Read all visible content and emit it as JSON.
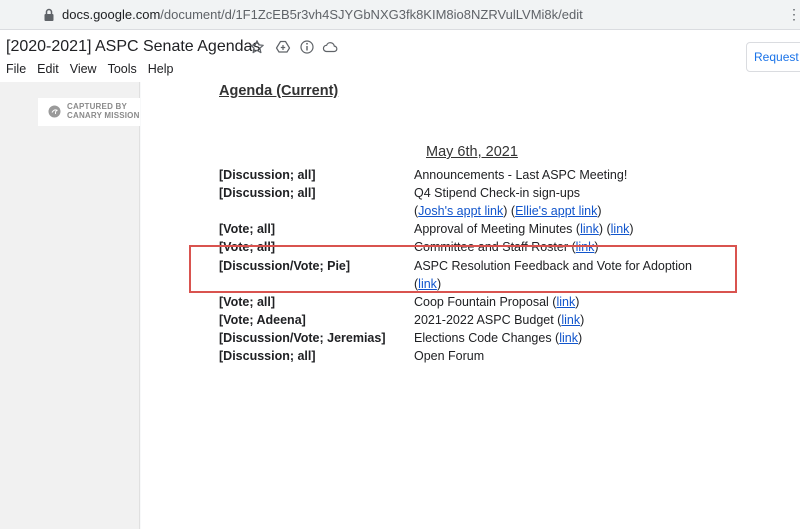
{
  "browser": {
    "url_domain": "docs.google.com",
    "url_path": "/document/d/1F1ZcEB5r3vh4SJYGbNXG3fk8KIM8io8NZRVulLVMi8k/edit",
    "more_glyph": "⋮"
  },
  "doc": {
    "title": "[2020-2021] ASPC Senate Agendas",
    "request_button": "Request e"
  },
  "menu": [
    "File",
    "Edit",
    "View",
    "Tools",
    "Help"
  ],
  "watermark": {
    "line1": "CAPTURED BY",
    "line2": "CANARY MISSION"
  },
  "content": {
    "heading": "Agenda (Current)",
    "date": "May 6th, 2021",
    "rows": [
      {
        "label": "[Discussion; all]",
        "segments": [
          {
            "text": "Announcements - Last ASPC Meeting!"
          }
        ]
      },
      {
        "label": "[Discussion; all]",
        "segments": [
          {
            "text": "Q4 Stipend Check-in sign-ups"
          }
        ]
      },
      {
        "label": "",
        "segments": [
          {
            "text": "("
          },
          {
            "text": "Josh's appt link",
            "link": true
          },
          {
            "text": ") ("
          },
          {
            "text": "Ellie's appt link",
            "link": true
          },
          {
            "text": ")"
          }
        ]
      },
      {
        "label": "[Vote; all]",
        "segments": [
          {
            "text": "Approval of Meeting Minutes ("
          },
          {
            "text": "link",
            "link": true
          },
          {
            "text": ") ("
          },
          {
            "text": "link",
            "link": true
          },
          {
            "text": ")"
          }
        ]
      },
      {
        "label": "[Vote; all]",
        "segments": [
          {
            "text": "Committee and Staff Roster ("
          },
          {
            "text": "link",
            "link": true
          },
          {
            "text": ")"
          }
        ]
      },
      {
        "label": "[Discussion/Vote; Pie]",
        "segments": [
          {
            "text": "ASPC Resolution Feedback and Vote for Adoption"
          }
        ]
      },
      {
        "label": "",
        "segments": [
          {
            "text": "("
          },
          {
            "text": "link",
            "link": true
          },
          {
            "text": ")"
          }
        ]
      },
      {
        "label": "[Vote; all]",
        "segments": [
          {
            "text": "Coop Fountain Proposal ("
          },
          {
            "text": "link",
            "link": true
          },
          {
            "text": ")"
          }
        ]
      },
      {
        "label": "[Vote; Adeena]",
        "segments": [
          {
            "text": "2021-2022 ASPC Budget ("
          },
          {
            "text": "link",
            "link": true
          },
          {
            "text": ")"
          }
        ]
      },
      {
        "label": "[Discussion/Vote; Jeremias]",
        "segments": [
          {
            "text": "Elections Code Changes ("
          },
          {
            "text": "link",
            "link": true
          },
          {
            "text": ")"
          }
        ]
      },
      {
        "label": "[Discussion; all]",
        "segments": [
          {
            "text": "Open Forum"
          }
        ]
      }
    ]
  },
  "colors": {
    "link": "#1155cc",
    "highlight_box": "#d9534f"
  }
}
